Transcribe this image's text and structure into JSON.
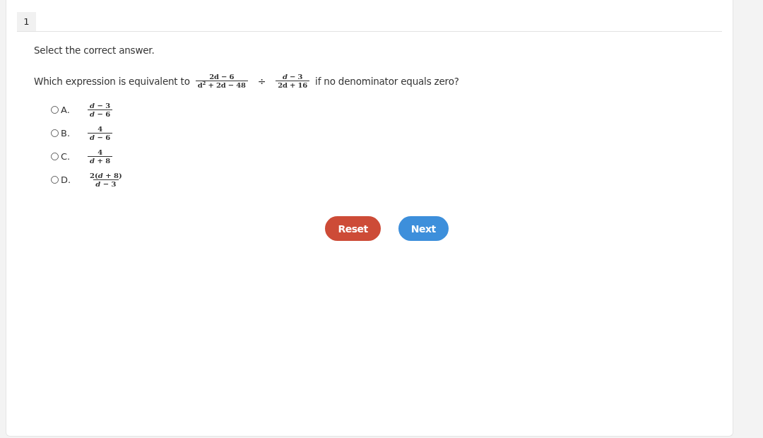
{
  "question_number": "1",
  "instruction": "Select the correct answer.",
  "question": {
    "prefix": "Which expression is equivalent to",
    "dividend": {
      "numerator": "2d − 6",
      "denominator": "d$^{2}$ + 2d − 48"
    },
    "operator": "÷",
    "divisor": {
      "numerator": "*d* − 3",
      "denominator": "2d + 16"
    },
    "suffix": "if no denominator equals zero?"
  },
  "options": [
    {
      "letter": "A.",
      "numerator": "*d* − 3",
      "denominator": "*d* − 6",
      "selected": false
    },
    {
      "letter": "B.",
      "numerator": "4",
      "denominator": "*d* − 6",
      "selected": false
    },
    {
      "letter": "C.",
      "numerator": "4",
      "denominator": "*d* + 8",
      "selected": false
    },
    {
      "letter": "D.",
      "numerator": "2(*d* + 8)",
      "denominator": "*d* − 3",
      "selected": false
    }
  ],
  "buttons": [
    {
      "kind": "reset",
      "label": "Reset"
    },
    {
      "kind": "next",
      "label": "Next"
    }
  ]
}
